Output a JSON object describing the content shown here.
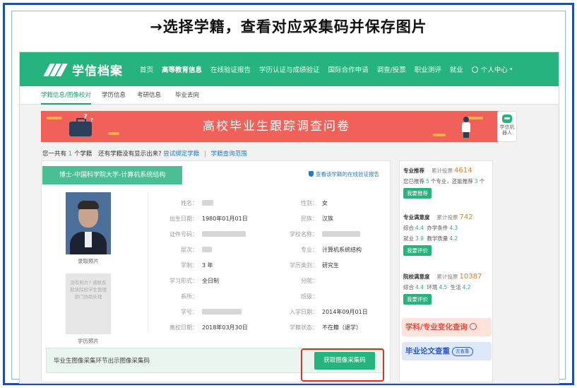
{
  "instruction": "→选择学籍，查看对应采集码并保存图片",
  "nav": {
    "logo": "学信档案",
    "items": [
      "首页",
      "高等教育信息",
      "在线验证报告",
      "学历认证与成绩验证",
      "国际合作申请",
      "调查/投票",
      "职业测评",
      "就业"
    ],
    "user": "个人中心"
  },
  "subnav": [
    "学籍信息/图像校对",
    "学历信息",
    "考研信息",
    "毕业去向"
  ],
  "banner": {
    "title": "高校毕业生跟踪调查问卷",
    "robot_label": "学信机器人"
  },
  "count_line": {
    "prefix": "您一共有",
    "count": "1",
    "suffix": "个学籍",
    "question": "还有学籍没有显示出来?",
    "link1": "尝试绑定学籍",
    "sep": "|",
    "link2": "学籍查询范围"
  },
  "record": {
    "school_tab": "博士-中国科学院大学-计算机系统结构",
    "verify_link": "查看该学籍的在线验证报告",
    "photo_caption_1": "录取照片",
    "photo_empty_text": "没有照片? 请联系就读院校学生管理部门协助处理",
    "photo_caption_2": "学历照片",
    "fields": {
      "name_lbl": "姓名：",
      "gender_lbl": "性别：",
      "gender_val": "女",
      "birth_lbl": "出生日期：",
      "birth_val": "1980年01月01日",
      "ethnic_lbl": "民族：",
      "ethnic_val": "汉族",
      "id_lbl": "证件号码：",
      "school_lbl": "学校名称：",
      "level_lbl": "层次：",
      "major_lbl": "专业：",
      "major_val": "计算机系统结构",
      "length_lbl": "学制：",
      "length_val": "3 年",
      "category_lbl": "学历类别：",
      "category_val": "研究生",
      "form_lbl": "学习形式：",
      "form_val": "全日制",
      "branch_lbl": "分院：",
      "dept_lbl": "系所：",
      "class_lbl": "班级：",
      "sid_lbl": "学号：",
      "enroll_lbl": "入学日期：",
      "enroll_val": "2014年09月01日",
      "leave_lbl": "离校日期：",
      "leave_val": "2018年03月30日",
      "status_lbl": "学籍状态：",
      "status_val": "不在籍（退学）"
    },
    "code_bar_text": "毕业生图像采集环节出示图像采集码",
    "code_button": "获取图像采集码"
  },
  "sidebar": {
    "major_rec": {
      "title": "专业推荐",
      "total_lbl": "累计投票",
      "total": "4614",
      "line_a": "您已推荐",
      "n1": "5",
      "line_b": "个专业，还能推荐",
      "n2": "3",
      "line_c": "个",
      "button": "我要推荐"
    },
    "major_sat": {
      "title": "专业满意度",
      "total_lbl": "累计投票",
      "total": "742",
      "k1": "综合",
      "v1": "4.4",
      "k2": "办学条件",
      "v2": "4.3",
      "k3": "就业",
      "v3": "3.9",
      "k4": "教学质量",
      "v4": "4.2",
      "button": "我要评价"
    },
    "school_sat": {
      "title": "院校满意度",
      "total_lbl": "累计投票",
      "total": "10387",
      "k1": "综合",
      "v1": "4.4",
      "k2": "环境",
      "v2": "4.5",
      "k3": "生活",
      "v3": "4.2",
      "button": "我要评价"
    },
    "promo1": "学科/专业变化查询",
    "promo2": "毕业论文查重",
    "promo2_pill": "去查重"
  }
}
